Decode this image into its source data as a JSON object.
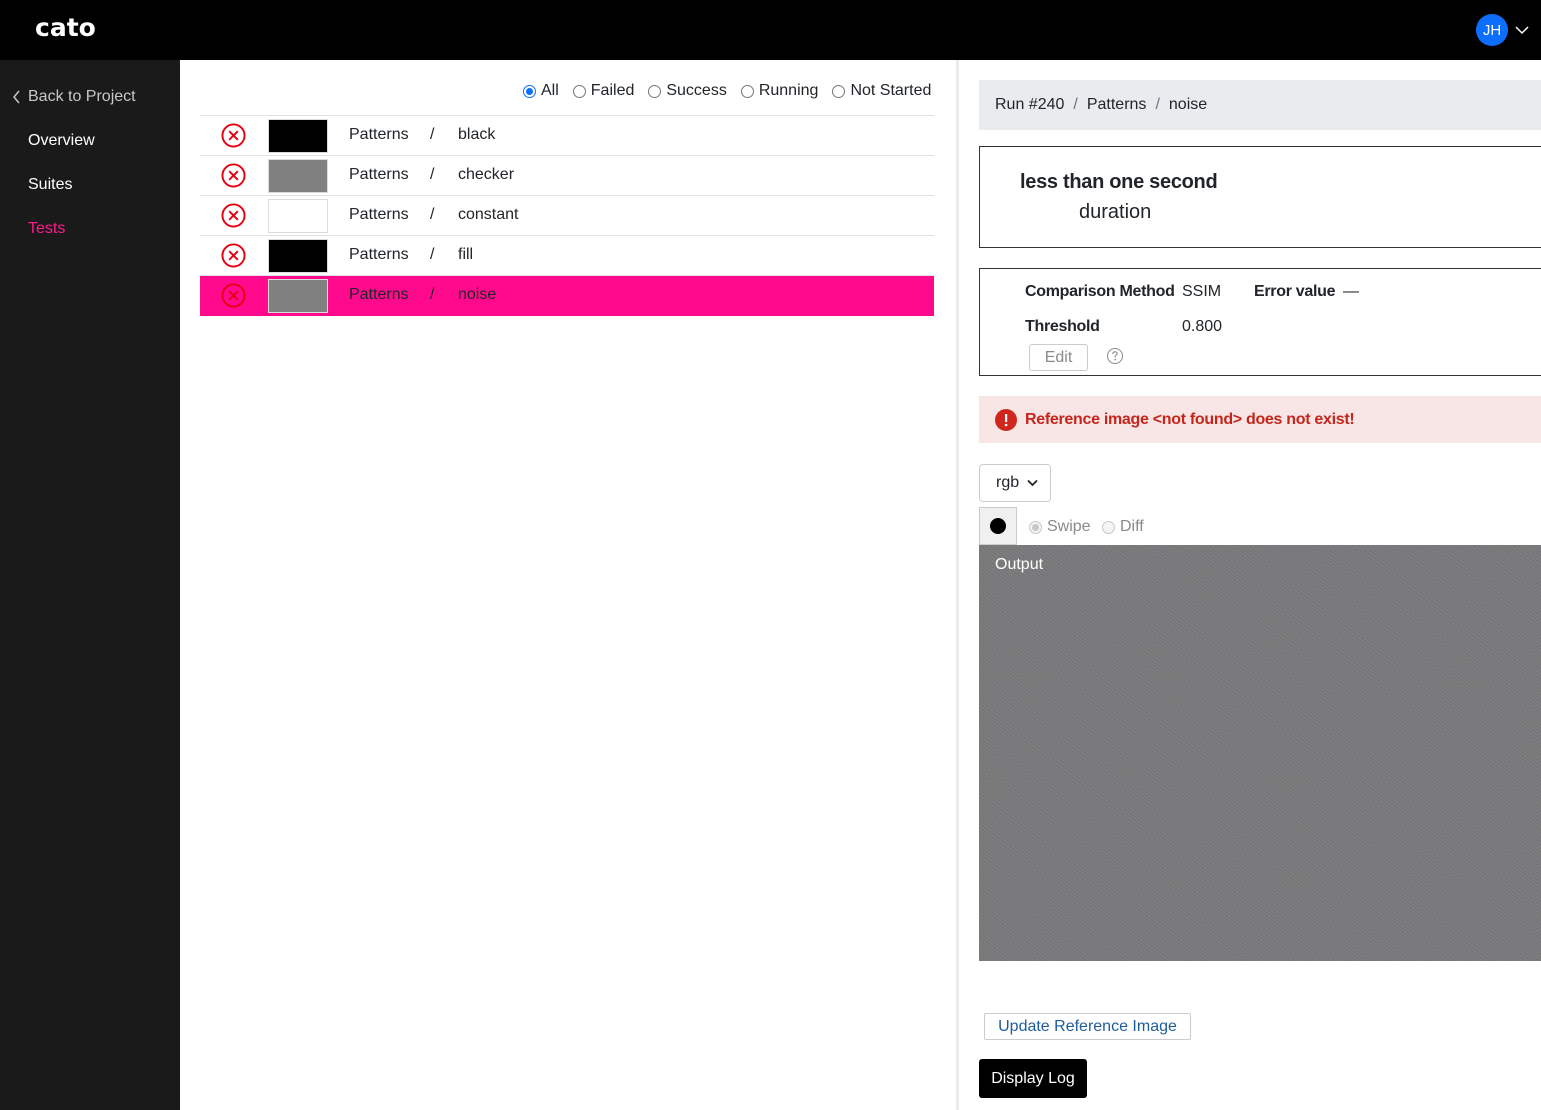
{
  "app": {
    "logo": "cato",
    "user_initials": "JH"
  },
  "sidebar": {
    "back_label": "Back to Project",
    "items": [
      {
        "label": "Overview",
        "active": false
      },
      {
        "label": "Suites",
        "active": false
      },
      {
        "label": "Tests",
        "active": true
      }
    ]
  },
  "filters": {
    "options": [
      "All",
      "Failed",
      "Success",
      "Running",
      "Not Started"
    ],
    "selected": "All"
  },
  "tests": [
    {
      "suite": "Patterns",
      "separator": "/",
      "name": "black",
      "status": "failed",
      "thumb_color": "#000000",
      "selected": false
    },
    {
      "suite": "Patterns",
      "separator": "/",
      "name": "checker",
      "status": "failed",
      "thumb_color": "#808080",
      "selected": false
    },
    {
      "suite": "Patterns",
      "separator": "/",
      "name": "constant",
      "status": "failed",
      "thumb_color": "#ffffff",
      "selected": false
    },
    {
      "suite": "Patterns",
      "separator": "/",
      "name": "fill",
      "status": "failed",
      "thumb_color": "#000000",
      "selected": false
    },
    {
      "suite": "Patterns",
      "separator": "/",
      "name": "noise",
      "status": "failed",
      "thumb_color": "#808080",
      "selected": true
    }
  ],
  "detail": {
    "breadcrumb": [
      "Run #240",
      "Patterns",
      "noise"
    ],
    "breadcrumb_separator": "/",
    "duration_value": "less than one second",
    "duration_label": "duration",
    "comparison_method_label": "Comparison Method",
    "comparison_method_value": "SSIM",
    "error_value_label": "Error value",
    "error_value": "—",
    "threshold_label": "Threshold",
    "threshold_value": "0.800",
    "edit_label": "Edit",
    "alert_text": "Reference image <not found> does not exist!",
    "channel_selected": "rgb",
    "view_modes": [
      "Swipe",
      "Diff"
    ],
    "view_mode_selected": "Swipe",
    "output_label": "Output",
    "update_reference_label": "Update Reference Image",
    "display_log_label": "Display Log"
  },
  "colors": {
    "accent": "#ff0a8d",
    "sidebar_active": "#ff1a8c",
    "failed_icon": "#e60012",
    "alert_text": "#c5261c",
    "alert_bg": "#f8e5e6"
  }
}
